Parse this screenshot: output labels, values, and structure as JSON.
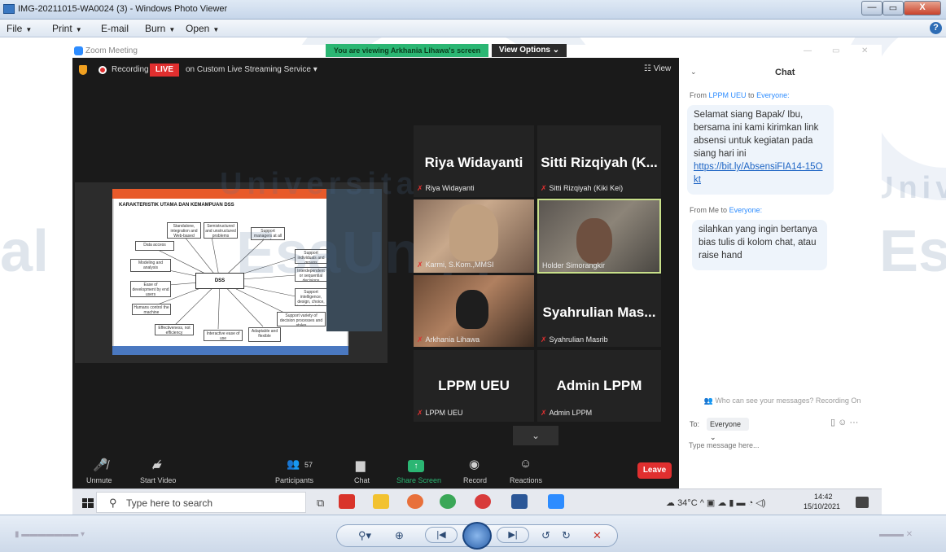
{
  "window": {
    "title": "IMG-20211015-WA0024 (3) - Windows Photo Viewer",
    "min_glyph": "—",
    "max_glyph": "▭",
    "close_glyph": "X"
  },
  "menu": {
    "file": "File",
    "print": "Print",
    "email": "E-mail",
    "burn": "Burn",
    "open": "Open",
    "help": "?"
  },
  "watermark": {
    "universitas": "Universitas",
    "esa": "Esa",
    "unggul": "Unggul",
    "univ": "Univ",
    "es": "Es",
    "al": "al"
  },
  "zoom": {
    "window_title": "Zoom Meeting",
    "viewing_banner": "You are viewing Arkhania Lihawa's screen",
    "view_options": "View Options ⌄",
    "recording": "Recording",
    "live": "LIVE",
    "stream": "on Custom Live Streaming Service ▾",
    "view": "☷ View"
  },
  "slide": {
    "title": "KARAKTERISTIK UTAMA DAN KEMAMPUAN DSS",
    "hub": "DSS",
    "boxes": [
      "Standalone, integration and Web-based",
      "Semistructured and unstructured problems",
      "Support managers at all levels",
      "Data access",
      "Support individuals and groups",
      "Modeling and analysis",
      "Interdependent or sequential decisions",
      "Ease of development by end users",
      "Support intelligence, design, choice, implementation",
      "Humans control the machine",
      "Support variety of decision processes and styles",
      "Effectiveness, not efficiency",
      "Interactive ease of use",
      "Adaptable and flexible"
    ]
  },
  "participants": [
    {
      "name": "Riya Widayanti",
      "label": "Riya Widayanti"
    },
    {
      "name": "Sitti Rizqiyah (K...",
      "label": "Sitti Rizqiyah (Kiki Kei)"
    },
    {
      "name": "",
      "label": "Karmi, S.Kom.,MMSI"
    },
    {
      "name": "",
      "label": "Holder Simorangkir"
    },
    {
      "name": "",
      "label": "Arkhania Lihawa"
    },
    {
      "name": "Syahrulian Mas...",
      "label": "Syahrulian Masrib"
    },
    {
      "name": "LPPM UEU",
      "label": "LPPM UEU"
    },
    {
      "name": "Admin LPPM",
      "label": "Admin LPPM"
    }
  ],
  "toolbar": {
    "unmute": "Unmute",
    "start_video": "Start Video",
    "participants": "Participants",
    "participants_count": "57",
    "chat": "Chat",
    "share_screen": "Share Screen",
    "record": "Record",
    "reactions": "Reactions",
    "leave": "Leave"
  },
  "chat": {
    "title": "Chat",
    "messages": [
      {
        "from_prefix": "From",
        "from": "LPPM UEU",
        "to_word": "to",
        "to": "Everyone:",
        "text": "Selamat siang Bapak/ Ibu, bersama ini kami kirimkan link absensi untuk kegiatan pada siang hari ini",
        "link": "https://bit.ly/AbsensiFIA14-15Okt"
      },
      {
        "from_prefix": "From",
        "from": "Me",
        "to_word": "to",
        "to": "Everyone:",
        "text": "silahkan yang ingin bertanya bias tulis di kolom chat, atau raise hand"
      }
    ],
    "hint": "Who can see your messages? Recording On",
    "to_label": "To:",
    "to_value": "Everyone ⌄",
    "input_placeholder": "Type message here..."
  },
  "taskbar": {
    "search_placeholder": "Type here to search",
    "weather": "34°C",
    "time": "14:42",
    "date": "15/10/2021"
  },
  "colors": {
    "live_red": "#e02f2f",
    "share_green": "#2bb673",
    "zoom_blue": "#2d8cff",
    "chat_bubble": "#eef4fb"
  }
}
